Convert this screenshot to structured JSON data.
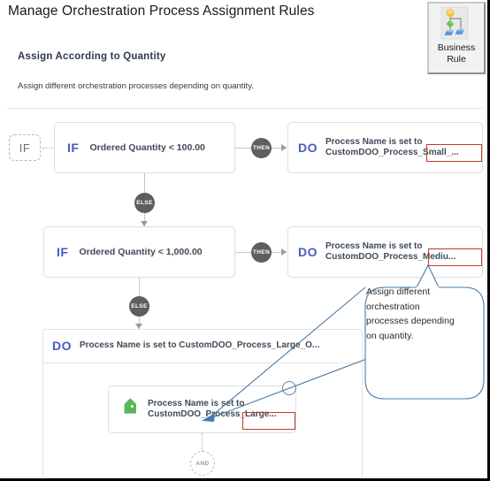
{
  "header": {
    "page_title": "Manage Orchestration Process Assignment Rules",
    "section_title": "Assign According to Quantity",
    "section_subtitle": "Assign different orchestration processes depending on quantity."
  },
  "business_rule_button": {
    "label_line1": "Business",
    "label_line2": "Rule",
    "icon": "business-rule-tree-icon"
  },
  "flow": {
    "if_chip_label": "IF",
    "rule1": {
      "keyword": "IF",
      "condition": "Ordered Quantity < 100.00",
      "connector_badge": "THEN",
      "action_keyword": "DO",
      "action_line1": "Process Name is set to",
      "action_line2": "CustomDOO_Process_Small_...",
      "highlight_text": "_Small_...",
      "highlight_color": "#c0392b"
    },
    "else_badge_1": "ELSE",
    "rule2": {
      "keyword": "IF",
      "condition": "Ordered Quantity < 1,000.00",
      "connector_badge": "THEN",
      "action_keyword": "DO",
      "action_line1": "Process Name is set to",
      "action_line2": "CustomDOO_Process_Mediu...",
      "highlight_text": "_Mediu...",
      "highlight_color": "#c0392b"
    },
    "else_badge_2": "ELSE",
    "rule3": {
      "action_keyword": "DO",
      "action_text": "Process Name is set to CustomDOO_Process_Large_O...",
      "inner_action": {
        "icon": "green-tag-icon",
        "line1": "Process Name is set to",
        "line2": "CustomDOO_Process_Large...",
        "highlight_text": "_Large...",
        "highlight_color": "#c0392b"
      },
      "and_badge": "AND"
    }
  },
  "callout": {
    "text": "Assign different orchestration processes depending on quantity.",
    "border_color": "#4a7ba7"
  }
}
